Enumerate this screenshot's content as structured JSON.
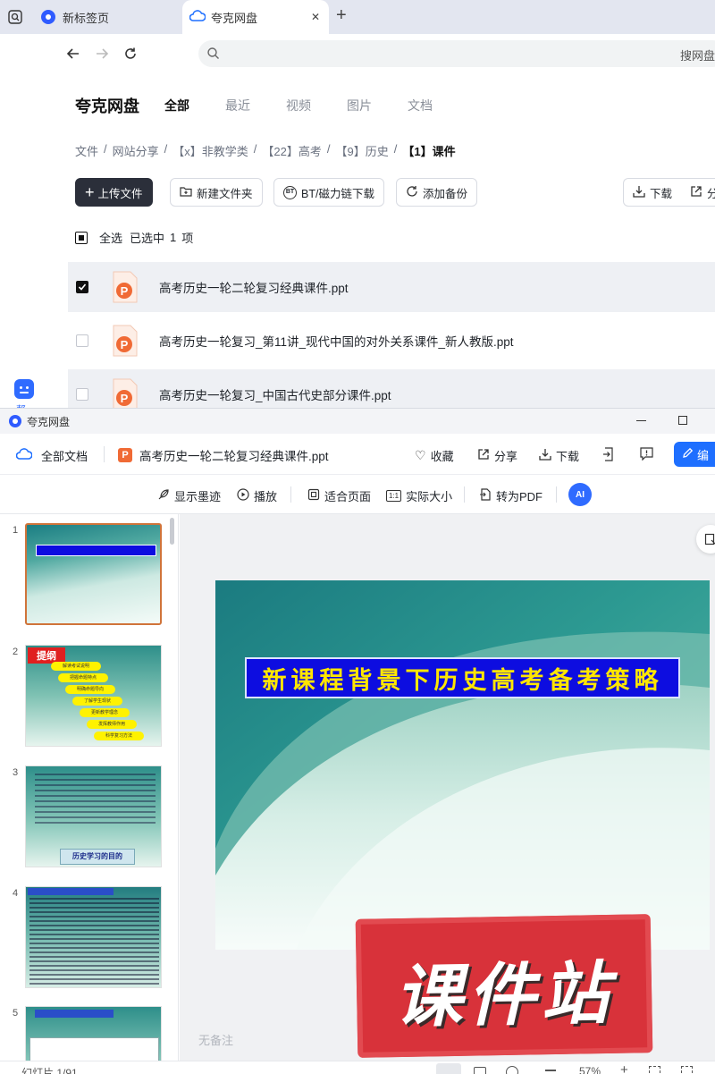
{
  "browser": {
    "tabs": [
      {
        "label": "新标签页",
        "active": false
      },
      {
        "label": "夸克网盘",
        "active": true
      }
    ],
    "new_tab_symbol": "+",
    "close_symbol": "✕",
    "address_placeholder": "搜网盘"
  },
  "drive": {
    "brand": "夸克网盘",
    "nav_tabs": [
      "全部",
      "最近",
      "视频",
      "图片",
      "文档"
    ],
    "breadcrumb": [
      "文件",
      "网站分享",
      "【x】非教学类",
      "【22】高考",
      "【9】历史",
      "【1】课件"
    ],
    "separator": "/",
    "actions": {
      "upload": "上传文件",
      "new_folder": "新建文件夹",
      "bt": "BT/磁力链下载",
      "backup": "添加备份",
      "download": "下载",
      "share": "分"
    },
    "selection": {
      "select_all": "全选",
      "selected": "已选中",
      "count": "1",
      "unit": "项"
    },
    "files": [
      {
        "name": "高考历史一轮二轮复习经典课件.ppt",
        "checked": true
      },
      {
        "name": "高考历史一轮复习_第11讲_现代中国的对外关系课件_新人教版.ppt",
        "checked": false
      },
      {
        "name": "高考历史一轮复习_中国古代史部分课件.ppt",
        "checked": false
      }
    ],
    "side_label": "帮"
  },
  "viewer": {
    "window_title": "夸克网盘",
    "all_docs": "全部文档",
    "file_name": "高考历史一轮二轮复习经典课件.ppt",
    "header_actions": {
      "favorite": "收藏",
      "share": "分享",
      "download": "下载",
      "edit": "编"
    },
    "toolbar": {
      "ink": "显示墨迹",
      "play": "播放",
      "fit": "适合页面",
      "actual": "实际大小",
      "topdf": "转为PDF",
      "ai": "AI"
    },
    "slide_numbers": [
      "1",
      "2",
      "3",
      "4",
      "5"
    ],
    "slide_title": "新课程背景下历史高考备考策略",
    "watermark": "课件站",
    "notes_placeholder": "无备注",
    "status": {
      "slide_counter": "幻灯片 1/91",
      "zoom": "57%"
    },
    "thumb_texts": {
      "t2_title": "提纲",
      "t2_items": [
        "解读考试说明",
        "把握命题特点",
        "明确命题导向",
        "了解学生现状",
        "更新教学理念",
        "发挥教师作用",
        "科学复习方法"
      ],
      "t3_heading": "历史学习的目的"
    }
  },
  "colors": {
    "accent": "#1e6fff",
    "dark_button": "#2b2f3a",
    "slide_teal": "#1e8c88",
    "title_bg": "#0d0de0",
    "title_fg": "#ffe600",
    "watermark_red": "#d8323a"
  }
}
